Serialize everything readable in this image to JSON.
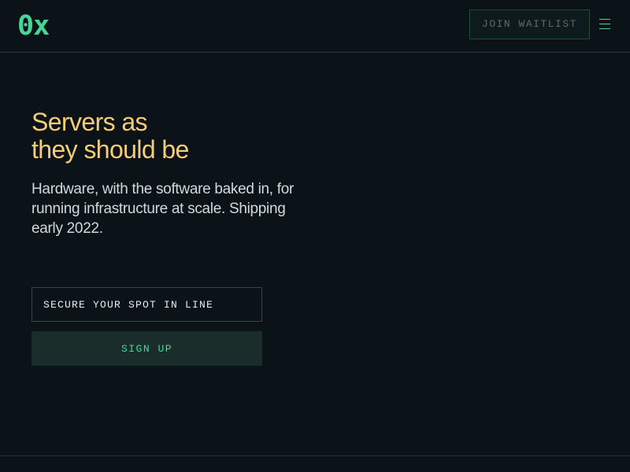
{
  "header": {
    "logo_text": "0x",
    "waitlist_label": "JOIN WAITLIST",
    "menu_icon": "hamburger-menu-icon"
  },
  "hero": {
    "title_line1": "Servers as",
    "title_line2": "they should be",
    "subtitle": "Hardware, with the software baked in, for running infrastructure at scale. Shipping early 2022."
  },
  "signup_form": {
    "email_placeholder": "SECURE YOUR SPOT IN LINE",
    "email_value": "",
    "submit_label": "SIGN UP"
  },
  "colors": {
    "background": "#0c1318",
    "accent_green": "#48d597",
    "title_yellow": "#f4cd74",
    "button_bg": "#1a2d2a"
  }
}
